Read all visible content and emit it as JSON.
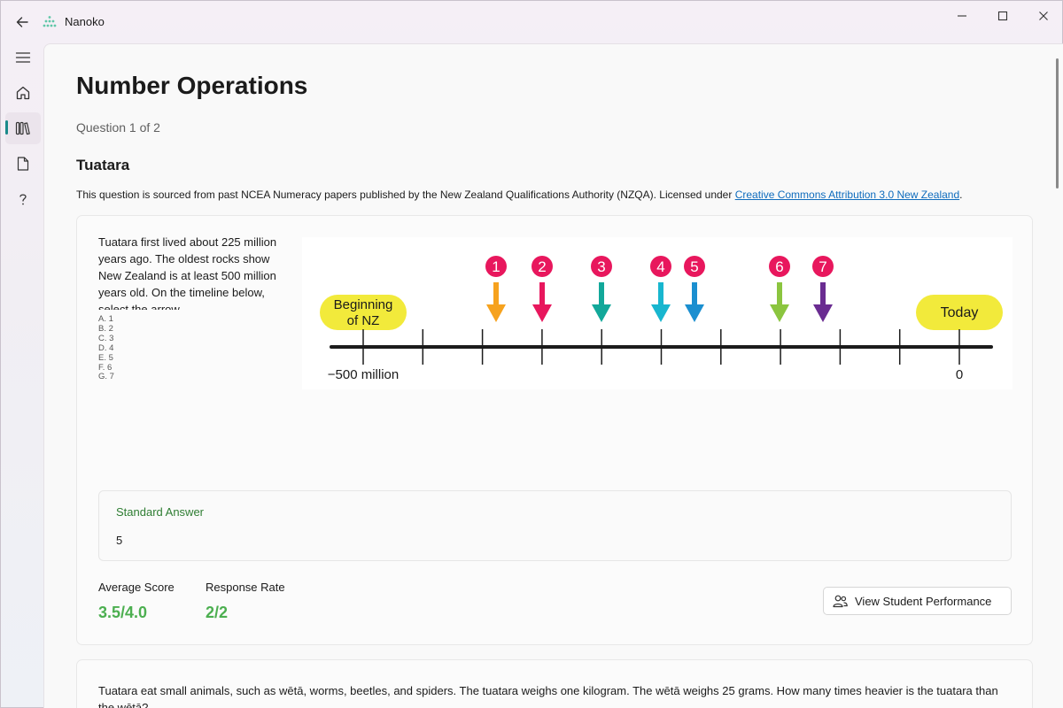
{
  "window": {
    "app_title": "Nanoko"
  },
  "sidebar": {
    "items": [
      {
        "name": "menu",
        "icon": "hamburger-icon"
      },
      {
        "name": "home",
        "icon": "home-icon"
      },
      {
        "name": "library",
        "icon": "library-icon",
        "active": true
      },
      {
        "name": "document",
        "icon": "document-icon"
      },
      {
        "name": "help",
        "icon": "help-icon"
      }
    ]
  },
  "main": {
    "page_title": "Number Operations",
    "question_count": "Question 1 of 2",
    "question_title": "Tuatara",
    "source_note_prefix": "This question is sourced from past NCEA Numeracy papers published by the New Zealand Qualifications Authority (NZQA). Licensed under ",
    "source_link": "Creative Commons Attribution 3.0 New Zealand",
    "source_note_suffix": "."
  },
  "question1": {
    "text": "Tuatara first lived about 225 million years ago. The oldest rocks show New Zealand is at least 500 million years old. On the timeline below, select the arrow",
    "options": [
      "A. 1",
      "B. 2",
      "C. 3",
      "D. 4",
      "E. 5",
      "F. 6",
      "G. 7"
    ],
    "timeline": {
      "start_label_line1": "Beginning",
      "start_label_line2": "of NZ",
      "end_label": "Today",
      "start_value": "−500 million",
      "end_value": "0",
      "arrows": [
        {
          "num": "1",
          "color": "#f6a21e"
        },
        {
          "num": "2",
          "color": "#e8175d"
        },
        {
          "num": "3",
          "color": "#12a89a"
        },
        {
          "num": "4",
          "color": "#18b6cf"
        },
        {
          "num": "5",
          "color": "#1b8fd0"
        },
        {
          "num": "6",
          "color": "#8bc53f"
        },
        {
          "num": "7",
          "color": "#6a2c91"
        }
      ],
      "badge_color": "#e8175d",
      "pill_color": "#f2ea3b"
    },
    "standard_answer_label": "Standard Answer",
    "standard_answer_value": "5",
    "average_score_label": "Average Score",
    "average_score_value": "3.5/4.0",
    "response_rate_label": "Response Rate",
    "response_rate_value": "2/2",
    "view_performance_label": "View Student Performance"
  },
  "question2": {
    "text": "Tuatara eat small animals, such as wētā, worms, beetles, and spiders. The tuatara weighs one kilogram. The wētā weighs 25 grams. How many times heavier is the tuatara than the wētā?"
  }
}
